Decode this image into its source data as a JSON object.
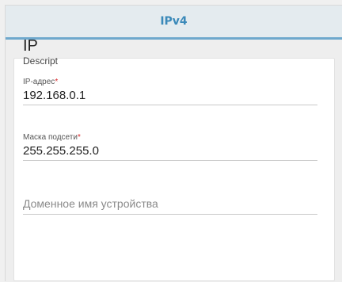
{
  "tab": {
    "title": "IPv4"
  },
  "section": {
    "title": "IP",
    "description": "Descript"
  },
  "fields": {
    "ip_address": {
      "label": "IP-адрес",
      "required_mark": "*",
      "value": "192.168.0.1"
    },
    "subnet_mask": {
      "label": "Маска подсети",
      "required_mark": "*",
      "value": "255.255.255.0"
    },
    "hostname": {
      "value": "",
      "placeholder": "Доменное имя устройства"
    }
  },
  "colors": {
    "accent": "#3b89b9",
    "tab_underline": "#6ea8cd",
    "required": "#d9262a",
    "header_bg": "#e4ebef"
  }
}
